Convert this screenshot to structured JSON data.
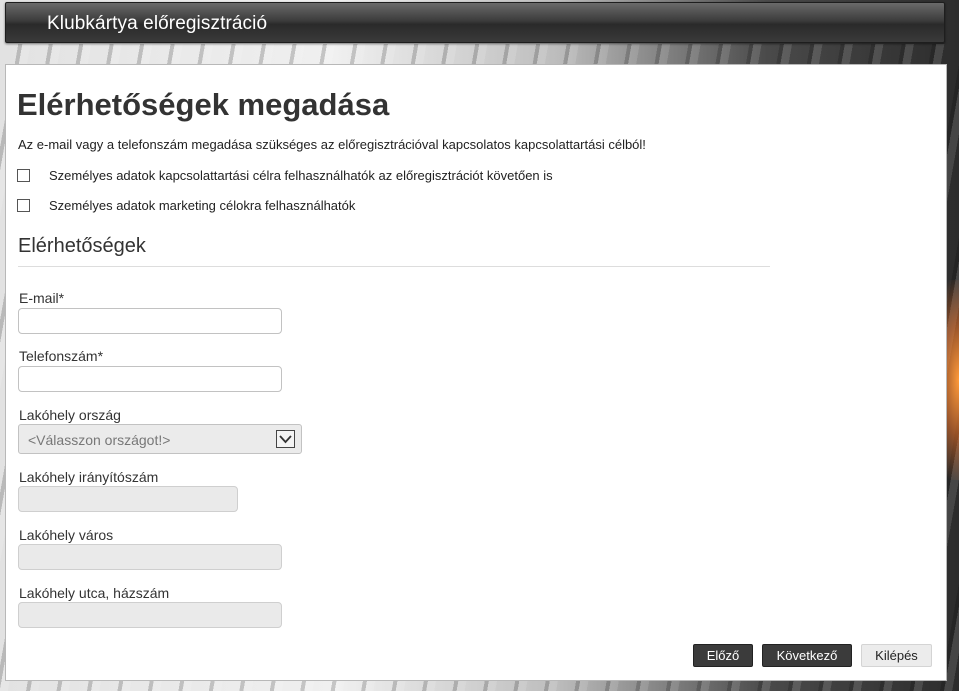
{
  "header": {
    "title": "Klubkártya előregisztráció"
  },
  "page": {
    "heading": "Elérhetőségek megadása",
    "intro": "Az e-mail vagy a telefonszám megadása szükséges az előregisztrációval kapcsolatos kapcsolattartási célból!"
  },
  "consents": [
    {
      "label": "Személyes adatok kapcsolattartási célra felhasználhatók az előregisztrációt követően is",
      "checked": false
    },
    {
      "label": "Személyes adatok marketing célokra felhasználhatók",
      "checked": false
    }
  ],
  "section": {
    "title": "Elérhetőségek"
  },
  "fields": {
    "email": {
      "label": "E-mail*",
      "value": ""
    },
    "phone": {
      "label": "Telefonszám*",
      "value": ""
    },
    "country": {
      "label": "Lakóhely ország",
      "value": "<Válasszon országot!>"
    },
    "zip": {
      "label": "Lakóhely irányítószám",
      "value": ""
    },
    "city": {
      "label": "Lakóhely város",
      "value": ""
    },
    "street": {
      "label": "Lakóhely utca, házszám",
      "value": ""
    }
  },
  "buttons": {
    "prev": "Előző",
    "next": "Következő",
    "exit": "Kilépés"
  },
  "icons": {
    "dropdown": "chevron-down-icon",
    "checkbox": "checkbox-icon"
  }
}
